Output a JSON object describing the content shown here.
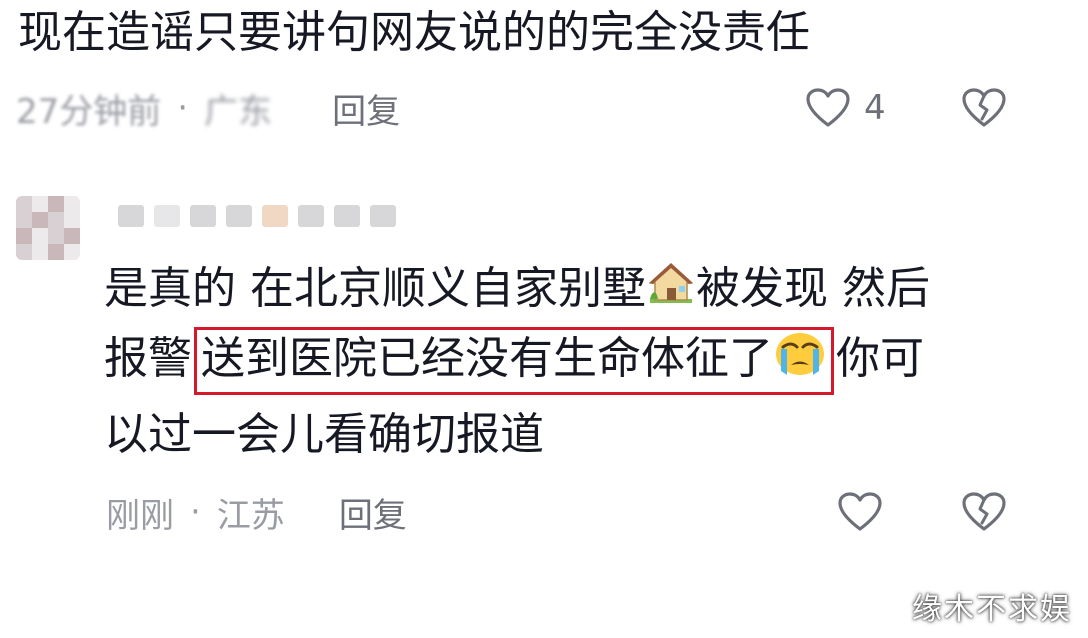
{
  "comment1": {
    "text": "现在造谣只要讲句网友说的的完全没责任",
    "time": "27分钟前",
    "separator": "·",
    "location": "广东",
    "reply_label": "回复",
    "like_count": "4"
  },
  "comment2": {
    "text_before": "是真的 在北京顺义自家别墅",
    "text_after_house": "被发现 然后",
    "text_line2_prefix": "报警",
    "highlighted_text": "送到医院已经没有生命体征了",
    "text_line2_suffix": "你可",
    "text_line3": "以过一会儿看确切报道",
    "time": "刚刚",
    "separator": "·",
    "location": "江苏",
    "reply_label": "回复"
  },
  "icons": {
    "like": "heart-outline-icon",
    "dislike": "broken-heart-icon",
    "house": "house-emoji-icon",
    "crying": "crying-face-emoji-icon"
  },
  "colors": {
    "highlight_border": "#d3192b",
    "meta_text": "#9a9ca3"
  },
  "watermark": "缘木不求娱"
}
